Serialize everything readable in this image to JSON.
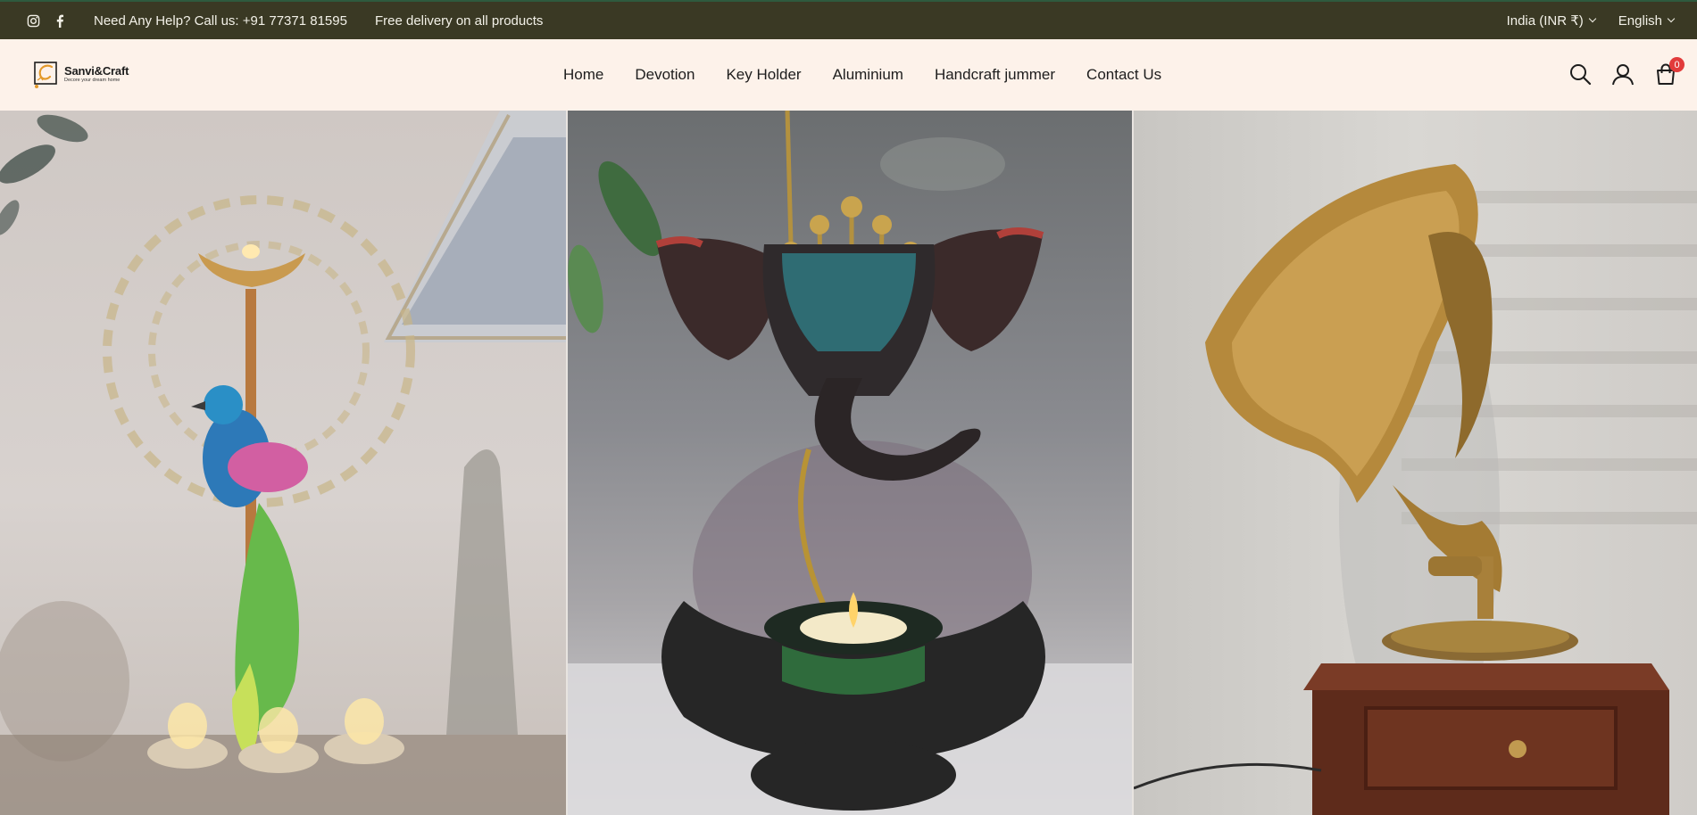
{
  "topbar": {
    "help_text": "Need Any Help? Call us: +91 77371 81595",
    "delivery_text": "Free delivery on all products",
    "currency": "India (INR ₹)",
    "language": "English"
  },
  "logo": {
    "name": "Sanvi&Craft",
    "tagline": "Decore your dream home"
  },
  "nav": {
    "items": [
      "Home",
      "Devotion",
      "Key Holder",
      "Aluminium",
      "Handcraft jummer",
      "Contact Us"
    ]
  },
  "cart": {
    "count": "0"
  },
  "colors": {
    "topbar_bg": "#3a3924",
    "header_bg": "#fdf2ea",
    "badge": "#e23b3b"
  },
  "icons": [
    "instagram-icon",
    "facebook-icon",
    "search-icon",
    "user-icon",
    "cart-icon"
  ]
}
